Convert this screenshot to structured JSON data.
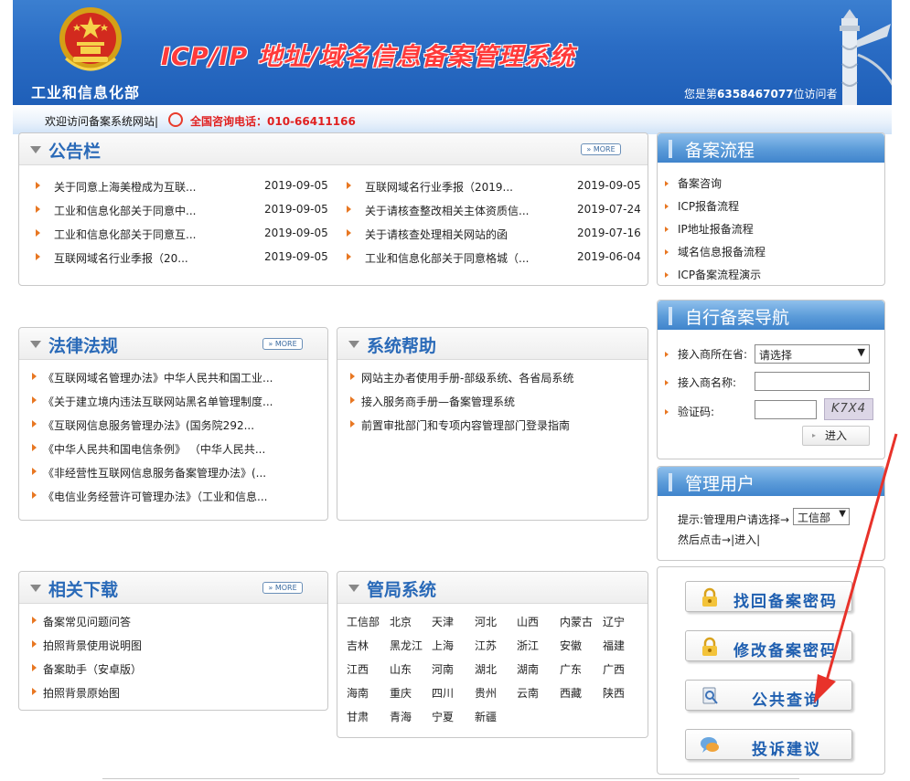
{
  "header": {
    "ministry": "工业和信息化部",
    "title": "ICP/IP 地址/域名信息备案管理系统",
    "visitor_prefix": "您是第",
    "visitor_count": "6358467077",
    "visitor_suffix": "位访问者"
  },
  "welcome_bar": {
    "welcome_text": "欢迎访问备案系统网站|",
    "phone_text": "全国咨询电话：010-66411166"
  },
  "announcements": {
    "title": "公告栏",
    "more": "» MORE",
    "left": [
      {
        "text": "关于同意上海美橙成为互联...",
        "date": "2019-09-05"
      },
      {
        "text": "工业和信息化部关于同意中...",
        "date": "2019-09-05"
      },
      {
        "text": "工业和信息化部关于同意互...",
        "date": "2019-09-05"
      },
      {
        "text": "互联网域名行业季报（20...",
        "date": "2019-09-05"
      }
    ],
    "right": [
      {
        "text": "互联网域名行业季报（2019...",
        "date": "2019-09-05"
      },
      {
        "text": "关于请核查整改相关主体资质信...",
        "date": "2019-07-24"
      },
      {
        "text": "关于请核查处理相关网站的函",
        "date": "2019-07-16"
      },
      {
        "text": "工业和信息化部关于同意格城（...",
        "date": "2019-06-04"
      }
    ]
  },
  "laws": {
    "title": "法律法规",
    "more": "» MORE",
    "items": [
      "《互联网域名管理办法》中华人民共和国工业...",
      "《关于建立境内违法互联网站黑名单管理制度...",
      "《互联网信息服务管理办法》(国务院292...",
      "《中华人民共和国电信条例》 （中华人民共...",
      "《非经营性互联网信息服务备案管理办法》(...",
      "《电信业务经营许可管理办法》（工业和信息..."
    ]
  },
  "help": {
    "title": "系统帮助",
    "items": [
      "网站主办者使用手册-部级系统、各省局系统",
      "接入服务商手册—备案管理系统",
      "前置审批部门和专项内容管理部门登录指南"
    ]
  },
  "downloads": {
    "title": "相关下载",
    "more": "» MORE",
    "items": [
      "备案常见问题问答",
      "拍照背景使用说明图",
      "备案助手（安卓版）",
      "拍照背景原始图"
    ]
  },
  "bureau": {
    "title": "管局系统",
    "rows": [
      [
        "工信部",
        "北京",
        "天津",
        "河北",
        "山西",
        "内蒙古",
        "辽宁"
      ],
      [
        "吉林",
        "黑龙江",
        "上海",
        "江苏",
        "浙江",
        "安徽",
        "福建"
      ],
      [
        "江西",
        "山东",
        "河南",
        "湖北",
        "湖南",
        "广东",
        "广西"
      ],
      [
        "海南",
        "重庆",
        "四川",
        "贵州",
        "云南",
        "西藏",
        "陕西"
      ],
      [
        "甘肃",
        "青海",
        "宁夏",
        "新疆"
      ]
    ]
  },
  "process": {
    "title": "备案流程",
    "items": [
      "备案咨询",
      "ICP报备流程",
      "IP地址报备流程",
      "域名信息报备流程",
      "ICP备案流程演示"
    ]
  },
  "self_nav": {
    "title": "自行备案导航",
    "location_label": "接入商所在省:",
    "location_value": "请选择",
    "name_label": "接入商名称:",
    "name_value": "",
    "captcha_label": "验证码:",
    "captcha_value": "",
    "captcha_image_text": "K7X4",
    "enter_label": "进入"
  },
  "admin": {
    "title": "管理用户",
    "hint_prefix": "提示:管理用户请选择→",
    "select_value": "工信部",
    "then_text": "然后点击→",
    "enter_link": "|进入|"
  },
  "actions": {
    "find_password": "找回备案密码",
    "change_password": "修改备案密码",
    "public_query": "公共查询",
    "complaint": "投诉建议"
  },
  "colors": {
    "header_blue": "#2a6cc4",
    "title_red": "#ff3a3a",
    "panel_title_blue": "#2a6ab8",
    "bullet_orange": "#e87722",
    "arrow_red": "#e8322a"
  }
}
